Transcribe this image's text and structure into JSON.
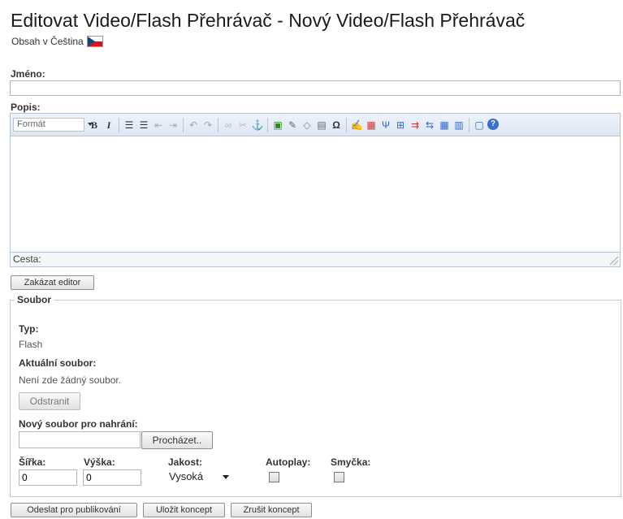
{
  "page": {
    "title": "Editovat Video/Flash Přehrávač - Nový Video/Flash Přehrávač",
    "subtitle": "Obsah v Čeština"
  },
  "form": {
    "name_label": "Jméno:",
    "name_value": "",
    "desc_label": "Popis:"
  },
  "editor": {
    "format_label": "Formát",
    "path_label": "Cesta:",
    "toolbar_icons": [
      "bold-icon",
      "italic-icon",
      "bulleted-list-icon",
      "numbered-list-icon",
      "outdent-icon",
      "indent-icon",
      "undo-icon",
      "redo-icon",
      "link-icon",
      "unlink-icon",
      "anchor-icon",
      "image-icon",
      "attach-icon",
      "embed-icon",
      "paste-icon",
      "special-char-icon",
      "edit-icon",
      "insert-icon",
      "table-row-icon",
      "table-col-icon",
      "table-merge-icon",
      "table-split-icon",
      "table-icon",
      "table-props-icon",
      "fullscreen-icon",
      "help-icon"
    ],
    "disable_label": "Zakázat editor"
  },
  "file_section": {
    "legend": "Soubor",
    "type_label": "Typ:",
    "type_value": "Flash",
    "current_label": "Aktuální soubor:",
    "current_value": "Není zde žádný soubor.",
    "remove_label": "Odstranit",
    "upload_label": "Nový soubor pro nahrání:",
    "browse_label": "Procházet..",
    "width_label": "Šířka:",
    "width_value": "0",
    "height_label": "Výška:",
    "height_value": "0",
    "quality_label": "Jakost:",
    "quality_value": "Vysoká",
    "autoplay_label": "Autoplay:",
    "loop_label": "Smyčka:"
  },
  "actions": {
    "publish_label": "Odeslat pro publikování",
    "save_draft_label": "Uložit koncept",
    "cancel_draft_label": "Zrušit koncept"
  },
  "colors": {
    "editor_border": "#b8c4d6",
    "toolbar_bg": "#dde6f3"
  }
}
